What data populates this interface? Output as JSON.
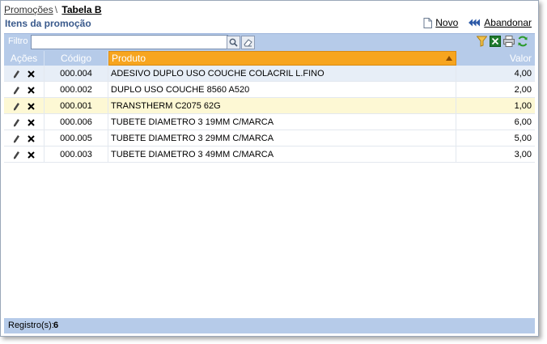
{
  "breadcrumb": {
    "parent": "Promoções",
    "separator": "\\",
    "current": "Tabela B"
  },
  "subtitle": "Itens da promoção",
  "actions": {
    "new_label": "Novo",
    "abandon_label": "Abandonar"
  },
  "filter": {
    "label": "Filtro",
    "value": ""
  },
  "table": {
    "columns": {
      "actions": "Ações",
      "code": "Código",
      "product": "Produto",
      "value": "Valor"
    },
    "rows": [
      {
        "code": "000.004",
        "product": "ADESIVO DUPLO USO COUCHE COLACRIL L.FINO",
        "value": "4,00"
      },
      {
        "code": "000.002",
        "product": "DUPLO USO COUCHE 8560 A520",
        "value": "2,00"
      },
      {
        "code": "000.001",
        "product": "TRANSTHERM C2075 62G",
        "value": "1,00"
      },
      {
        "code": "000.006",
        "product": "TUBETE DIAMETRO 3 19MM C/MARCA",
        "value": "6,00"
      },
      {
        "code": "000.005",
        "product": "TUBETE DIAMETRO 3 29MM C/MARCA",
        "value": "5,00"
      },
      {
        "code": "000.003",
        "product": "TUBETE DIAMETRO 3 49MM C/MARCA",
        "value": "3,00"
      }
    ]
  },
  "footer": {
    "label": "Registro(s):",
    "count": "6"
  },
  "colors": {
    "header_bg": "#b6cbe9",
    "sort_column": "#f7a51f",
    "title": "#3a5a8c"
  },
  "icons": [
    "document-icon",
    "rewind-icon",
    "search-icon",
    "eraser-icon",
    "filter-icon",
    "excel-icon",
    "print-icon",
    "refresh-icon",
    "pencil-icon",
    "delete-icon",
    "sort-asc-icon"
  ]
}
